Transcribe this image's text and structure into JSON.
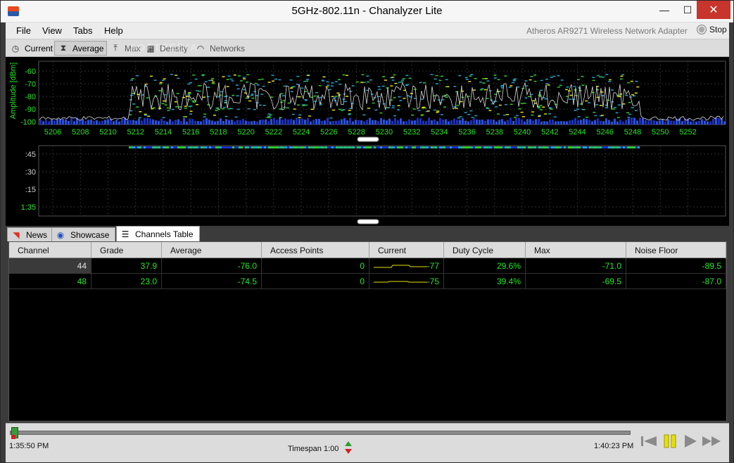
{
  "window": {
    "title": "5GHz-802.11n - Chanalyzer Lite",
    "close_glyph": "✕",
    "min_glyph": "—",
    "max_glyph": "☐"
  },
  "menu": {
    "items": [
      "File",
      "View",
      "Tabs",
      "Help"
    ],
    "adapter": "Atheros AR9271 Wireless Network Adapter",
    "stop_label": "Stop"
  },
  "toolbar": {
    "current": "Current",
    "average": "Average",
    "max": "Max",
    "density": "Density",
    "networks": "Networks",
    "watermark": "SOFTPEDIA"
  },
  "spectrum": {
    "ylabel": "Amplitude [dBm]",
    "y_ticks": [
      "-60",
      "-70",
      "-80",
      "-90",
      "-100"
    ],
    "x_ticks": [
      "5206",
      "5208",
      "5210",
      "5212",
      "5214",
      "5216",
      "5218",
      "5220",
      "5222",
      "5224",
      "5226",
      "5228",
      "5230",
      "5232",
      "5234",
      "5236",
      "5238",
      "5240",
      "5242",
      "5244",
      "5246",
      "5248",
      "5250",
      "5252"
    ]
  },
  "waterfall": {
    "y_ticks": [
      ":45",
      ":30",
      ":15",
      "1:35"
    ]
  },
  "tabs": {
    "news": "News",
    "showcase": "Showcase",
    "channels_table": "Channels Table"
  },
  "table": {
    "headers": [
      "Channel",
      "Grade",
      "Average",
      "Access Points",
      "Current",
      "Duty Cycle",
      "Max",
      "Noise Floor"
    ],
    "rows": [
      {
        "channel": "44",
        "grade": "37.9",
        "average": "-76.0",
        "access_points": "0",
        "current": "-77",
        "duty_cycle": "29.6%",
        "max": "-71.0",
        "noise_floor": "-89.5"
      },
      {
        "channel": "48",
        "grade": "23.0",
        "average": "-74.5",
        "access_points": "0",
        "current": "-75",
        "duty_cycle": "39.4%",
        "max": "-69.5",
        "noise_floor": "-87.0"
      }
    ]
  },
  "timeline": {
    "start": "1:35:50 PM",
    "end": "1:40:23 PM",
    "timespan": "Timespan 1:00"
  },
  "colors": {
    "plot_bg": "#000000",
    "grid": "#3a3a3a",
    "label_green": "#22e822",
    "trace": "#d8d8d8",
    "accent_yellow": "#e8e000"
  }
}
